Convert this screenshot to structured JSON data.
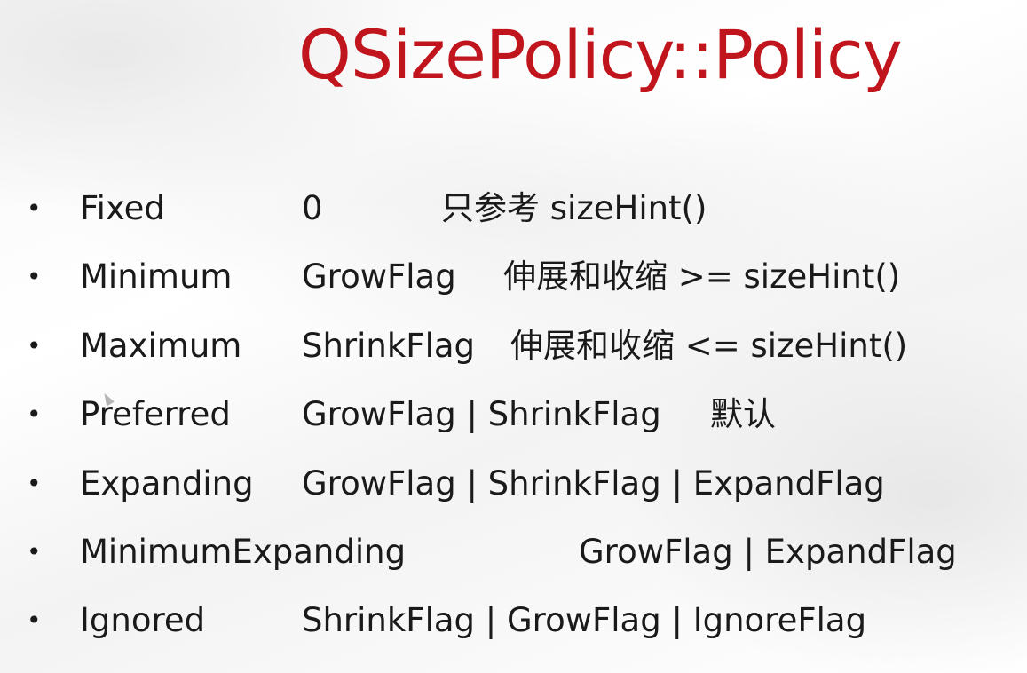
{
  "title": "QSizePolicy::Policy",
  "bullet_glyph": "•",
  "items": [
    {
      "name": "Fixed",
      "value": "0",
      "desc": "只参考 sizeHint()"
    },
    {
      "name": "Minimum",
      "value": "GrowFlag",
      "desc": "伸展和收缩 >= sizeHint()"
    },
    {
      "name": "Maximum",
      "value": "ShrinkFlag",
      "desc": "伸展和收缩 <= sizeHint()"
    },
    {
      "name": "Preferred",
      "value": "GrowFlag | ShrinkFlag",
      "desc": "默认"
    },
    {
      "name": "Expanding",
      "value": "GrowFlag | ShrinkFlag | ExpandFlag",
      "desc": ""
    },
    {
      "name": "MinimumExpanding",
      "value": "GrowFlag | ExpandFlag",
      "desc": ""
    },
    {
      "name": "Ignored",
      "value": "ShrinkFlag | GrowFlag | IgnoreFlag",
      "desc": ""
    }
  ],
  "colors": {
    "title": "#c0151c",
    "text": "#1a1a1a"
  }
}
